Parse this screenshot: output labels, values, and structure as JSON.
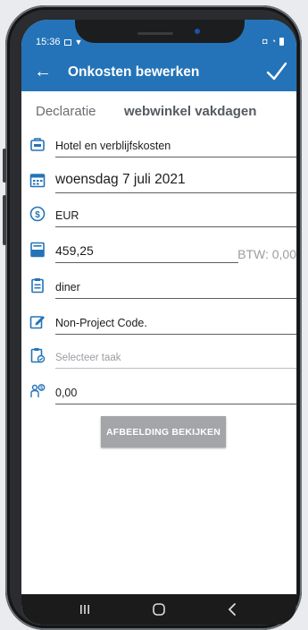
{
  "status": {
    "time": "15:36"
  },
  "toolbar": {
    "title": "Onkosten bewerken"
  },
  "header": {
    "label": "Declaratie",
    "value": "webwinkel vakdagen"
  },
  "fields": {
    "category": "Hotel en verblijfskosten",
    "date": "woensdag 7 juli 2021",
    "currency": "EUR",
    "amount": "459,25",
    "btw": "BTW: 0,00",
    "description": "diner",
    "project": "Non-Project Code.",
    "task_placeholder": "Selecteer taak",
    "extra_amount": "0,00"
  },
  "buttons": {
    "view_image": "AFBEELDING BEKIJKEN"
  },
  "colors": {
    "accent": "#2473b8",
    "icon": "#2473b8",
    "button": "#a3a5a8"
  },
  "icons": [
    "back-arrow-icon",
    "checkmark-icon",
    "briefcase-icon",
    "calendar-icon",
    "currency-icon",
    "receipt-icon",
    "clipboard-icon",
    "edit-icon",
    "task-icon",
    "person-money-icon"
  ]
}
